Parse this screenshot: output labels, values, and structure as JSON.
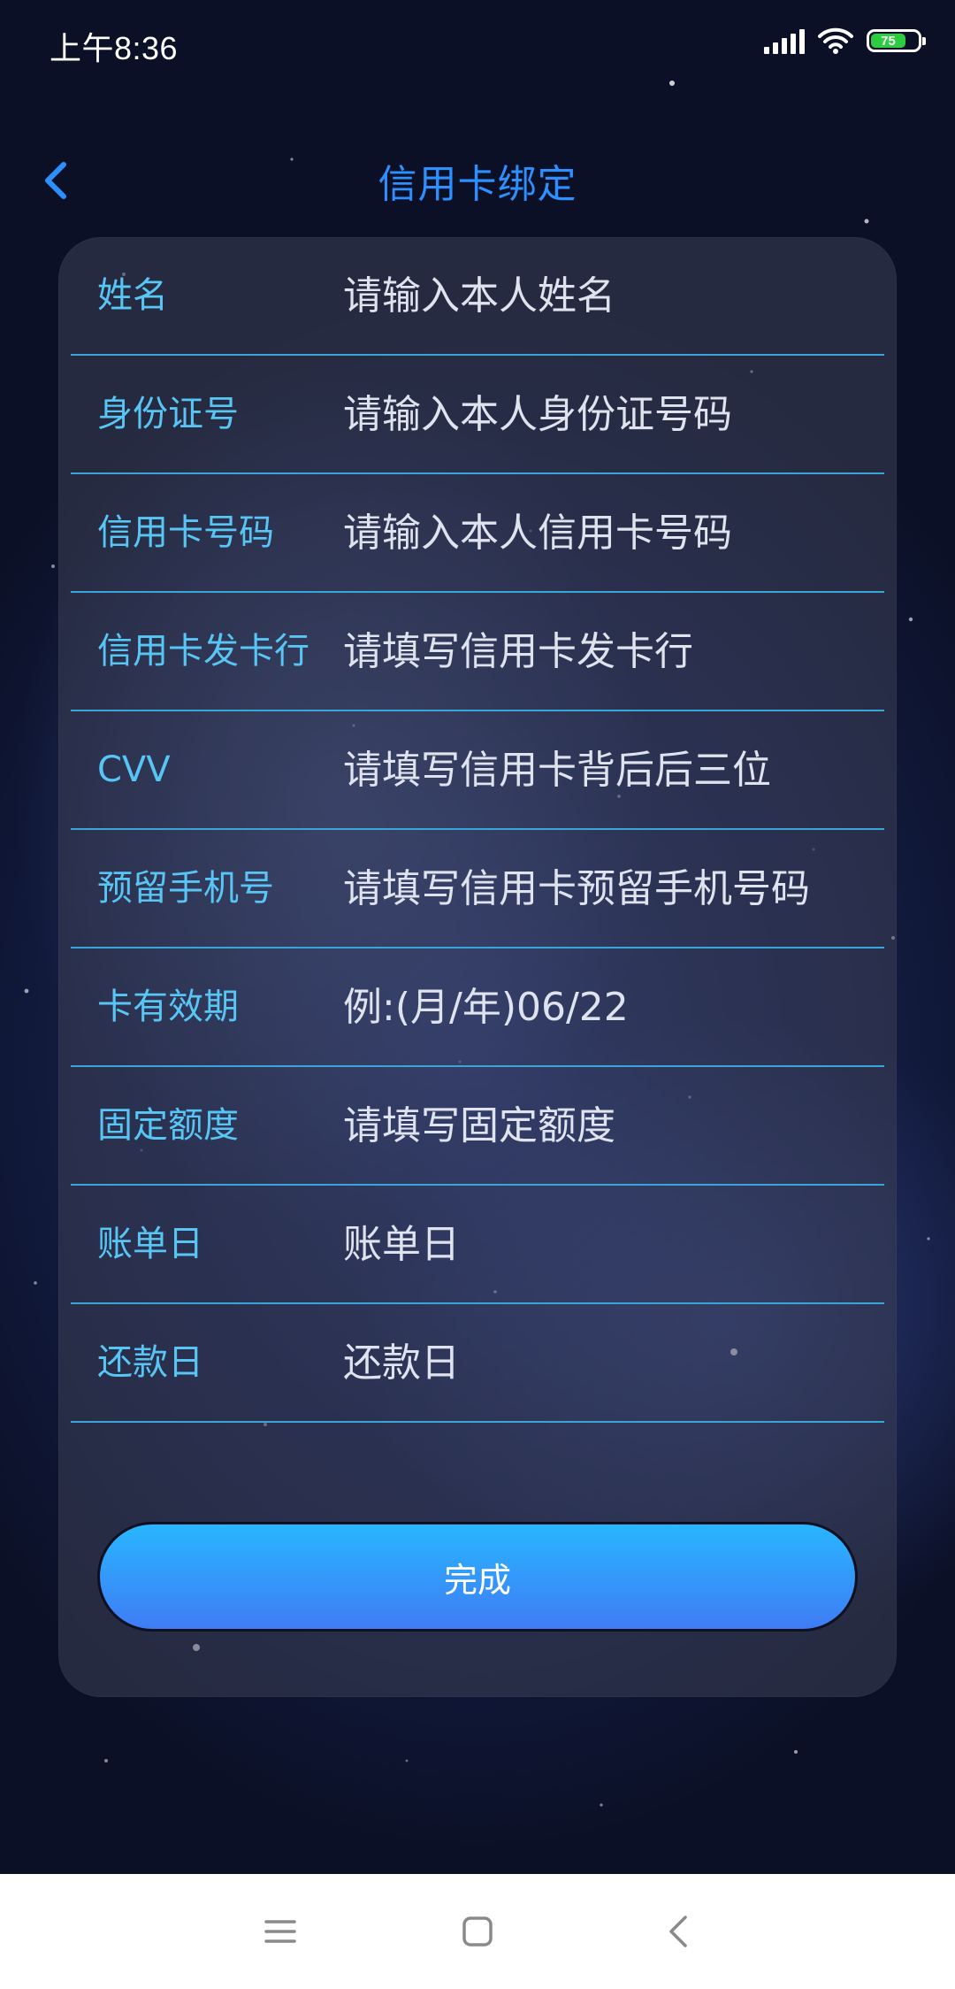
{
  "status_bar": {
    "time": "上午8:36",
    "battery_level": "75",
    "battery_color": "#2ecc40"
  },
  "header": {
    "title": "信用卡绑定",
    "back_icon": "chevron-left-icon"
  },
  "form": {
    "fields": [
      {
        "label": "姓名",
        "placeholder": "请输入本人姓名",
        "value": ""
      },
      {
        "label": "身份证号",
        "placeholder": "请输入本人身份证号码",
        "value": ""
      },
      {
        "label": "信用卡号码",
        "placeholder": "请输入本人信用卡号码",
        "value": ""
      },
      {
        "label": "信用卡发卡行",
        "placeholder": "请填写信用卡发卡行",
        "value": ""
      },
      {
        "label": "CVV",
        "placeholder": "请填写信用卡背后后三位",
        "value": ""
      },
      {
        "label": "预留手机号",
        "placeholder": "请填写信用卡预留手机号码",
        "value": ""
      },
      {
        "label": "卡有效期",
        "placeholder": "例:(月/年)06/22",
        "value": ""
      },
      {
        "label": "固定额度",
        "placeholder": "请填写固定额度",
        "value": ""
      },
      {
        "label": "账单日",
        "placeholder": "账单日",
        "value": ""
      },
      {
        "label": "还款日",
        "placeholder": "还款日",
        "value": ""
      }
    ],
    "submit_label": "完成"
  },
  "colors": {
    "accent": "#2e8fff",
    "label": "#58c6f5",
    "divider": "#3aa5d9",
    "button_top": "#28b6ff",
    "button_bottom": "#3f7cf5"
  },
  "nav_bar": {
    "icons": [
      "menu-icon",
      "home-square-icon",
      "back-triangle-icon"
    ]
  }
}
